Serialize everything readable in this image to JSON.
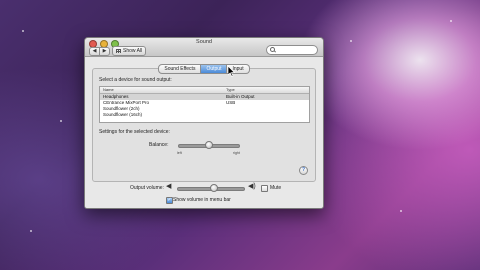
{
  "window": {
    "title": "Sound"
  },
  "toolbar": {
    "back_label": "◀",
    "forward_label": "▶",
    "show_all_label": "Show All",
    "search_placeholder": ""
  },
  "tabs": [
    {
      "label": "Sound Effects",
      "active": false
    },
    {
      "label": "Output",
      "active": true
    },
    {
      "label": "Input",
      "active": false
    }
  ],
  "output": {
    "select_label": "Select a device for sound output:",
    "columns": [
      "Name",
      "Type"
    ],
    "devices": [
      {
        "name": "Headphones",
        "type": "Built-in Output",
        "selected": true
      },
      {
        "name": "CEntrance MixPort Pro",
        "type": "USB",
        "selected": false
      },
      {
        "name": "Soundflower (2ch)",
        "type": "",
        "selected": false
      },
      {
        "name": "Soundflower (16ch)",
        "type": "",
        "selected": false
      }
    ],
    "settings_label": "Settings for the selected device:",
    "balance_label": "Balance:",
    "balance_left": "left",
    "balance_right": "right",
    "balance_value": 0.5
  },
  "footer": {
    "output_volume_label": "Output volume:",
    "volume_level": 0.55,
    "mute_label": "Mute",
    "mute_checked": false,
    "show_volume_label": "Show volume in menu bar",
    "show_volume_checked": true
  },
  "icons": {
    "help": "help-icon",
    "speaker_low": "speaker-low-icon",
    "speaker_high": "speaker-high-icon"
  }
}
